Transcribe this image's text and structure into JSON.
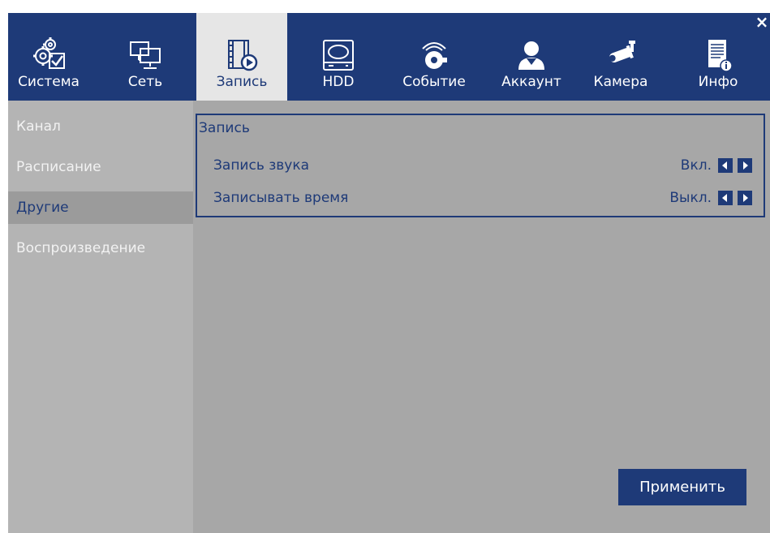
{
  "window": {
    "close_symbol": "×"
  },
  "tabs": [
    {
      "label": "Система",
      "icon": "settings-gear-icon",
      "active": false
    },
    {
      "label": "Сеть",
      "icon": "network-monitors-icon",
      "active": false
    },
    {
      "label": "Запись",
      "icon": "film-record-icon",
      "active": true
    },
    {
      "label": "HDD",
      "icon": "hard-drive-icon",
      "active": false
    },
    {
      "label": "Событие",
      "icon": "alarm-bell-icon",
      "active": false
    },
    {
      "label": "Аккаунт",
      "icon": "user-account-icon",
      "active": false
    },
    {
      "label": "Камера",
      "icon": "bullet-camera-icon",
      "active": false
    },
    {
      "label": "Инфо",
      "icon": "info-document-icon",
      "active": false
    }
  ],
  "sidebar": {
    "items": [
      {
        "label": "Канал",
        "active": false
      },
      {
        "label": "Расписание",
        "active": false
      },
      {
        "label": "Другие",
        "active": true
      },
      {
        "label": "Воспроизведение",
        "active": false
      }
    ]
  },
  "record_group": {
    "title": "Запись",
    "rows": [
      {
        "label": "Запись звука",
        "value": "Вкл."
      },
      {
        "label": "Записывать время",
        "value": "Выкл."
      }
    ]
  },
  "apply_label": "Применить",
  "colors": {
    "accent": "#1e3a78",
    "panel_bg": "#a7a7a7",
    "sidebar_bg": "#b4b4b4",
    "active_tab_bg": "#e6e6e6"
  }
}
